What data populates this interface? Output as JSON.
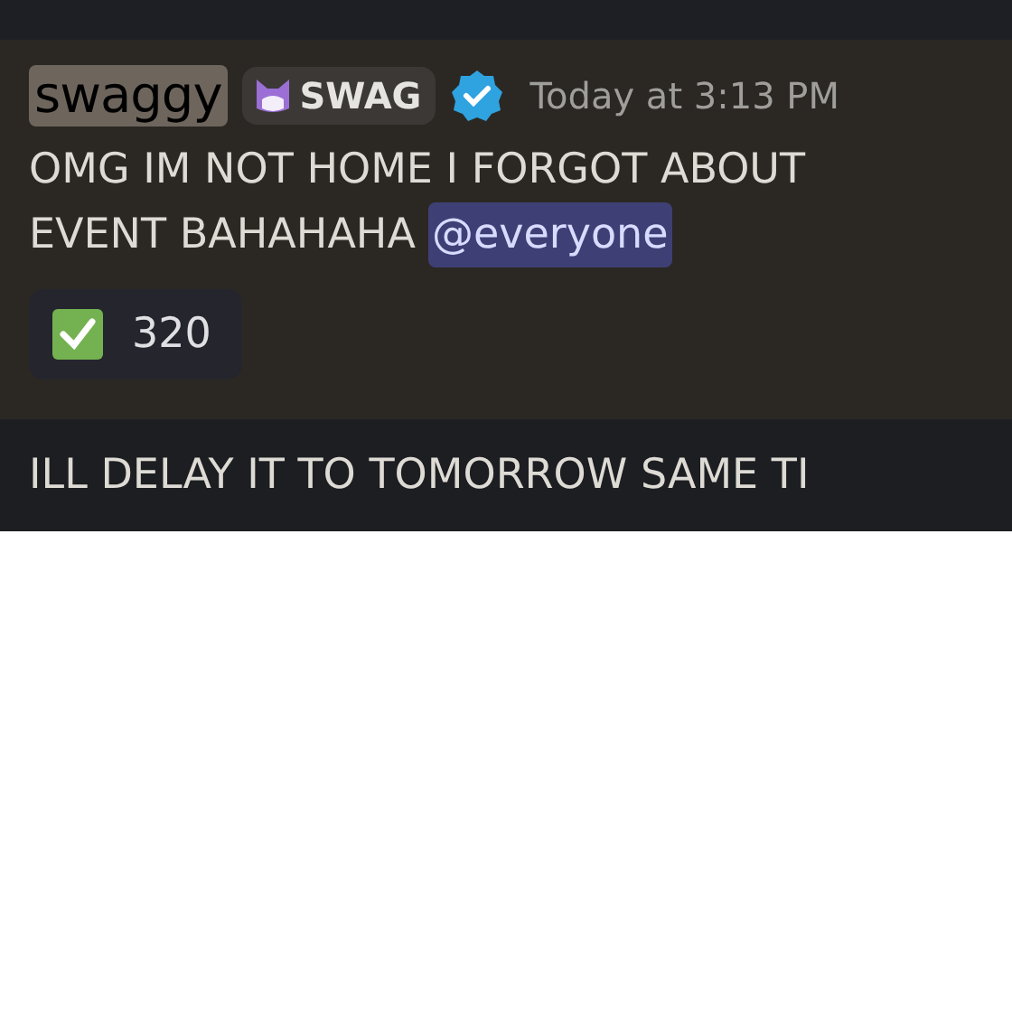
{
  "message": {
    "author": "swaggy",
    "role_tag": "SWAG",
    "verified": true,
    "timestamp": "Today at 3:13 PM",
    "lines": [
      "OMG IM NOT HOME I FORGOT ABOUT",
      "EVENT BAHAHAHA"
    ],
    "mention": "@everyone",
    "reactions": [
      {
        "count": "320",
        "selected": false
      }
    ]
  },
  "next_message": {
    "text": "ILL DELAY IT TO TOMORROW SAME TI"
  }
}
